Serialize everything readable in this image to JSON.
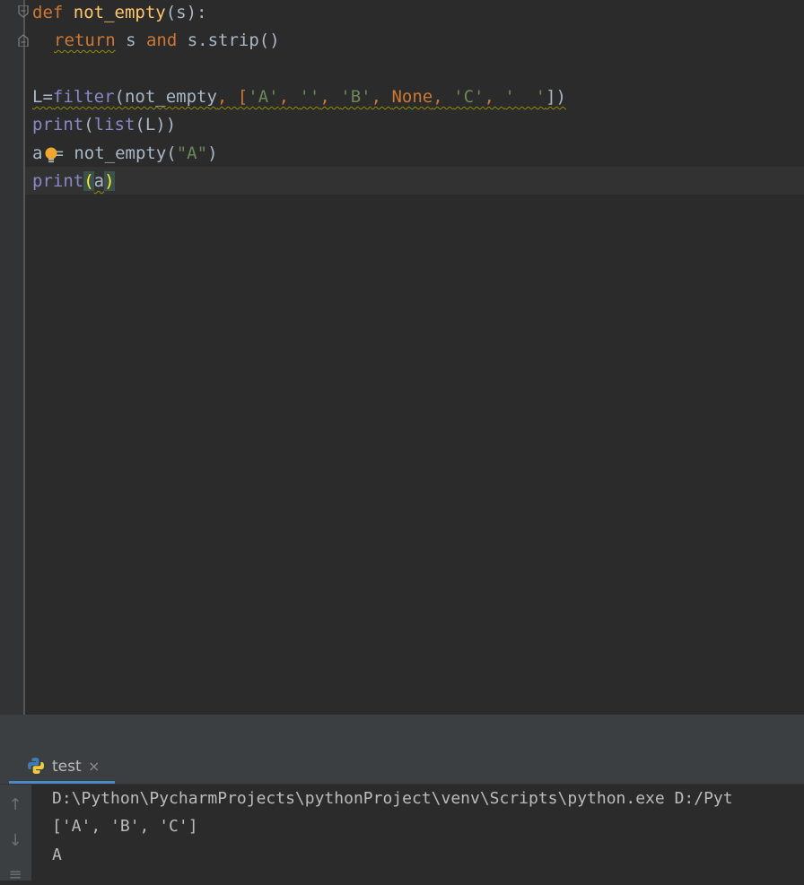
{
  "editor": {
    "lines": {
      "l1": {
        "kw": "def",
        "fn": "not_empty",
        "rest": "(s):"
      },
      "l2": {
        "kw_return": "return",
        "mid": " s ",
        "kw_and": "and",
        "rest": " s.strip()"
      },
      "l4": {
        "p1": "L=",
        "filter": "filter",
        "p2": "(not_empty",
        "p3": ", [",
        "s1": "'A'",
        "c1": ", ",
        "s2": "''",
        "c2": ", ",
        "s3": "'B'",
        "c3": ", ",
        "none": "None",
        "c4": ", ",
        "s4": "'C'",
        "c5": ", ",
        "s5": "'  '",
        "end": "])"
      },
      "l5": {
        "print": "print",
        "p1": "(",
        "list": "list",
        "rest": "(L))"
      },
      "l6": {
        "a": "a",
        "eq": "= ",
        "call": "not_empty(",
        "str": "\"A\"",
        "end": ")"
      },
      "l7": {
        "print": "print",
        "open": "(",
        "a": "a",
        "close": ")"
      }
    },
    "icons": {
      "fold": "fold-icon",
      "bulb": "intention-bulb-icon"
    }
  },
  "run_panel": {
    "tab_label": "test",
    "tab_close": "×",
    "output": [
      "D:\\Python\\PycharmProjects\\pythonProject\\venv\\Scripts\\python.exe D:/Pyt",
      "['A', 'B', 'C']",
      "A"
    ],
    "toolbar": {
      "up": "↑",
      "down": "↓",
      "wrap": "≡"
    }
  },
  "colors": {
    "background": "#2b2b2b",
    "keyword": "#cc7832",
    "function": "#ffc66d",
    "builtin": "#8888c6",
    "string": "#6a8759",
    "default": "#a9b7c6"
  }
}
